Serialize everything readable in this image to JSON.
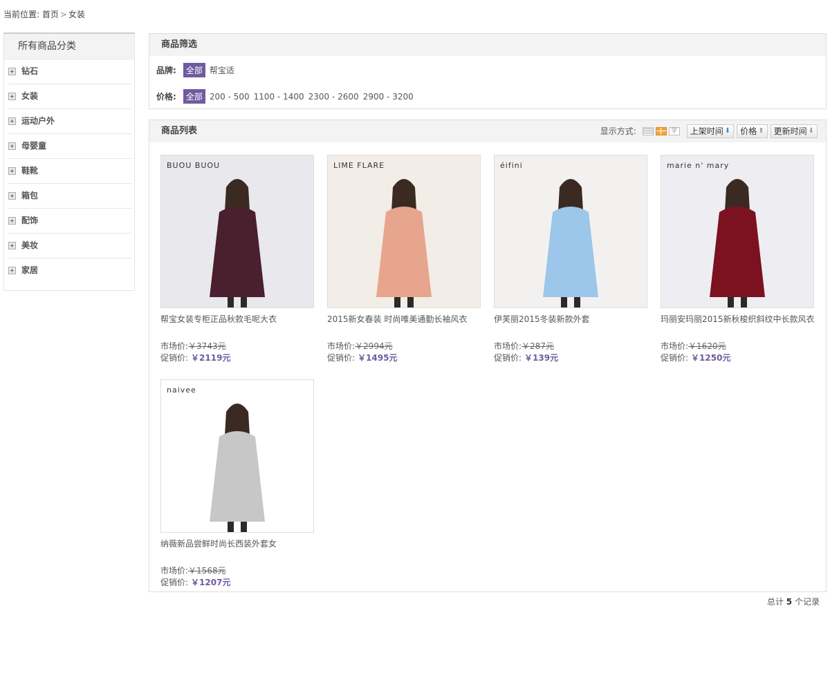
{
  "breadcrumb": {
    "prefix": "当前位置:",
    "home": "首页",
    "separator": ">",
    "current": "女装"
  },
  "sidebar": {
    "title": "所有商品分类",
    "items": [
      {
        "label": "钻石"
      },
      {
        "label": "女装"
      },
      {
        "label": "运动户外"
      },
      {
        "label": "母婴童"
      },
      {
        "label": "鞋靴"
      },
      {
        "label": "箱包"
      },
      {
        "label": "配饰"
      },
      {
        "label": "美妆"
      },
      {
        "label": "家居"
      }
    ]
  },
  "filter": {
    "title": "商品筛选",
    "brand_label": "品牌:",
    "all_label": "全部",
    "brands": [
      "帮宝适"
    ],
    "price_label": "价格:",
    "prices": [
      "200 - 500",
      "1100 - 1400",
      "2300 - 2600",
      "2900 - 3200"
    ]
  },
  "list": {
    "title": "商品列表",
    "display_label": "显示方式:",
    "view_text_glyph": "字",
    "sort": {
      "time_label": "上架时间",
      "price_label": "价格",
      "update_label": "更新时间"
    },
    "market_label": "市场价:",
    "promo_label": "促销价:",
    "products": [
      {
        "name": "帮宝女装专柜正品秋款毛呢大衣",
        "brand": "BUOU BUOU",
        "market": "￥3743元",
        "promo": "￥2119元",
        "coat": "#4a1f2e",
        "bg": "#e9e8ec"
      },
      {
        "name": "2015新女春装 时尚唯美通勤长袖风衣",
        "brand": "LIME FLARE",
        "market": "￥2994元",
        "promo": "￥1495元",
        "coat": "#e7a58e",
        "bg": "#f2ede6"
      },
      {
        "name": "伊芙丽2015冬装新款外套",
        "brand": "éifini",
        "market": "￥287元",
        "promo": "￥139元",
        "coat": "#9cc6ea",
        "bg": "#f3f1ef"
      },
      {
        "name": "玛丽安玛丽2015新秋梭织斜纹中长款风衣",
        "brand": "marie n' mary",
        "market": "￥1620元",
        "promo": "￥1250元",
        "coat": "#7c1220",
        "bg": "#eeeef2"
      },
      {
        "name": "纳薇新品尝鲜时尚长西装外套女",
        "brand": "naivee",
        "market": "￥1568元",
        "promo": "￥1207元",
        "coat": "#c7c7c7",
        "bg": "#ffffff"
      }
    ]
  },
  "footer": {
    "total_prefix": "总计",
    "total_count": "5",
    "total_suffix": "个记录"
  }
}
